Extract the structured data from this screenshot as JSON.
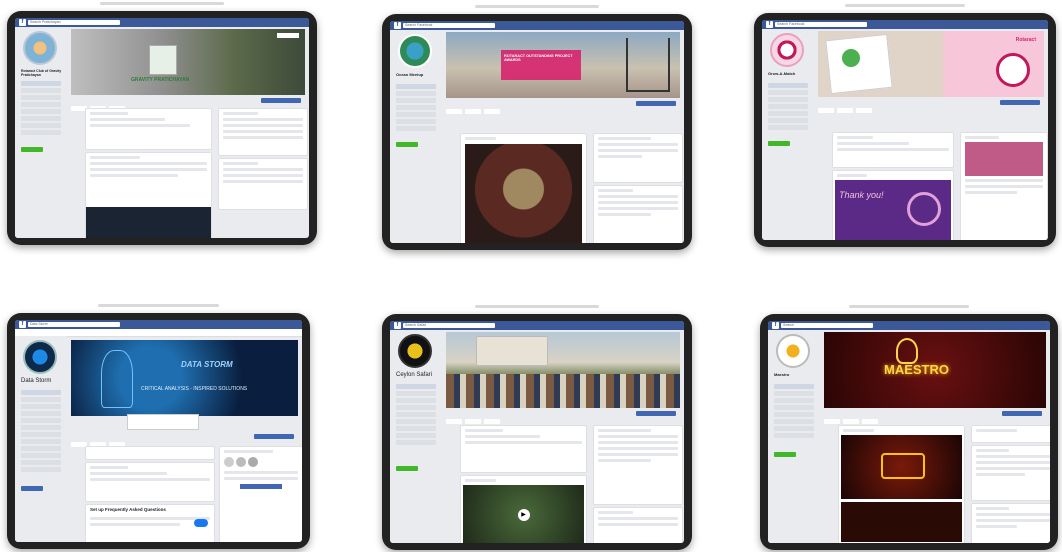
{
  "tablets": [
    {
      "page_name": "Rotaract Club of Gravity Pratichayan",
      "cover_title": "GRAVITY PRATICHAYAN",
      "search": "Search Pratichayan"
    },
    {
      "page_name": "Ocean Meetup",
      "cover_title": "ROTARACT OUTSTANDING PROJECT AWARDS",
      "search": "Search Facebook"
    },
    {
      "page_name": "Grow-A-Match",
      "cover_title": "Rotaract",
      "post_title": "Thank you!",
      "search": "Search Facebook"
    },
    {
      "page_name": "Data Storm",
      "cover_title": "DATA STORM",
      "cover_subtitle": "CRITICAL ANALYSIS - INSPIRED SOLUTIONS",
      "faq_title": "Set up Frequently Asked Questions",
      "search": "Data Storm"
    },
    {
      "page_name": "Ceylon Safari",
      "search": "Search Safari"
    },
    {
      "page_name": "Maestro",
      "cover_title": "MAESTRO",
      "search": "Search"
    }
  ],
  "colors": {
    "facebook_blue": "#3b5998",
    "button_blue": "#4267b2",
    "green": "#42b72a",
    "rotaract_pink": "#d6246e"
  }
}
